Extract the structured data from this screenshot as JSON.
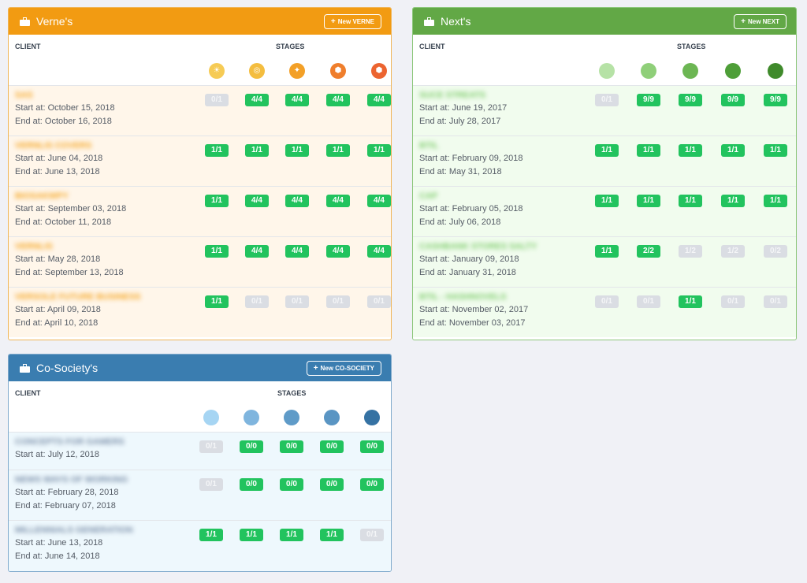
{
  "panels": [
    {
      "id": "verne",
      "title": "Verne's",
      "new_label": "New VERNE",
      "colors": {
        "header": "#f29b12",
        "border": "#f0b556",
        "row_bg": "#fff6ea",
        "name": "#f5a623"
      },
      "client_label": "CLIENT",
      "stages_label": "STAGES",
      "stage_icons": [
        {
          "name": "sun-icon",
          "color": "#f6cb55"
        },
        {
          "name": "globe-icon",
          "color": "#f4bd3f"
        },
        {
          "name": "compass-icon",
          "color": "#f3a027"
        },
        {
          "name": "cube-icon",
          "color": "#ef7e2c"
        },
        {
          "name": "box-icon",
          "color": "#ec6430"
        }
      ],
      "rows": [
        {
          "name": "SAS",
          "start": "Start at: October 15, 2018",
          "end": "End at: October 16, 2018",
          "stages": [
            {
              "v": "0/1",
              "s": "x"
            },
            {
              "v": "4/4",
              "s": "g"
            },
            {
              "v": "4/4",
              "s": "g"
            },
            {
              "v": "4/4",
              "s": "g"
            },
            {
              "v": "4/4",
              "s": "g"
            }
          ]
        },
        {
          "name": "VERNLIS COVERS",
          "start": "Start at: June 04, 2018",
          "end": "End at: June 13, 2018",
          "stages": [
            {
              "v": "1/1",
              "s": "g"
            },
            {
              "v": "1/1",
              "s": "g"
            },
            {
              "v": "1/1",
              "s": "g"
            },
            {
              "v": "1/1",
              "s": "g"
            },
            {
              "v": "1/1",
              "s": "g"
            }
          ]
        },
        {
          "name": "BIOSAKWPY",
          "start": "Start at: September 03, 2018",
          "end": "End at: October 11, 2018",
          "stages": [
            {
              "v": "1/1",
              "s": "g"
            },
            {
              "v": "4/4",
              "s": "g"
            },
            {
              "v": "4/4",
              "s": "g"
            },
            {
              "v": "4/4",
              "s": "g"
            },
            {
              "v": "4/4",
              "s": "g"
            }
          ]
        },
        {
          "name": "VERNLIS",
          "start": "Start at: May 28, 2018",
          "end": "End at: September 13, 2018",
          "stages": [
            {
              "v": "1/1",
              "s": "g"
            },
            {
              "v": "4/4",
              "s": "g"
            },
            {
              "v": "4/4",
              "s": "g"
            },
            {
              "v": "4/4",
              "s": "g"
            },
            {
              "v": "4/4",
              "s": "g"
            }
          ]
        },
        {
          "name": "VERSOLE FUTURE BUSINESS",
          "start": "Start at: April 09, 2018",
          "end": "End at: April 10, 2018",
          "stages": [
            {
              "v": "1/1",
              "s": "g"
            },
            {
              "v": "0/1",
              "s": "x"
            },
            {
              "v": "0/1",
              "s": "x"
            },
            {
              "v": "0/1",
              "s": "x"
            },
            {
              "v": "0/1",
              "s": "x"
            }
          ]
        }
      ]
    },
    {
      "id": "next",
      "title": "Next's",
      "new_label": "New NEXT",
      "colors": {
        "header": "#62a846",
        "border": "#8cc77a",
        "row_bg": "#f1fcee",
        "name": "#7dcc6a"
      },
      "client_label": "CLIENT",
      "stages_label": "STAGES",
      "stage_icons": [
        {
          "name": "stage-1-dot-icon",
          "color": "#b6e2a6"
        },
        {
          "name": "stage-2-dot-icon",
          "color": "#8fcf79"
        },
        {
          "name": "stage-3-dot-icon",
          "color": "#6cb653"
        },
        {
          "name": "stage-4-dot-icon",
          "color": "#4e9e38"
        },
        {
          "name": "stage-5-dot-icon",
          "color": "#3f8a2b"
        }
      ],
      "rows": [
        {
          "name": "SUCE STREATS",
          "start": "Start at: June 19, 2017",
          "end": "End at: July 28, 2017",
          "stages": [
            {
              "v": "0/1",
              "s": "x"
            },
            {
              "v": "9/9",
              "s": "g"
            },
            {
              "v": "9/9",
              "s": "g"
            },
            {
              "v": "9/9",
              "s": "g"
            },
            {
              "v": "9/9",
              "s": "g"
            }
          ]
        },
        {
          "name": "BTIL",
          "start": "Start at: February 09, 2018",
          "end": "End at: May 31, 2018",
          "stages": [
            {
              "v": "1/1",
              "s": "g"
            },
            {
              "v": "1/1",
              "s": "g"
            },
            {
              "v": "1/1",
              "s": "g"
            },
            {
              "v": "1/1",
              "s": "g"
            },
            {
              "v": "1/1",
              "s": "g"
            }
          ]
        },
        {
          "name": "CAP",
          "start": "Start at: February 05, 2018",
          "end": "End at: July 06, 2018",
          "stages": [
            {
              "v": "1/1",
              "s": "g"
            },
            {
              "v": "1/1",
              "s": "g"
            },
            {
              "v": "1/1",
              "s": "g"
            },
            {
              "v": "1/1",
              "s": "g"
            },
            {
              "v": "1/1",
              "s": "g"
            }
          ]
        },
        {
          "name": "CASHBANK STORES SALTY",
          "start": "Start at: January 09, 2018",
          "end": "End at: January 31, 2018",
          "stages": [
            {
              "v": "1/1",
              "s": "g"
            },
            {
              "v": "2/2",
              "s": "g"
            },
            {
              "v": "1/2",
              "s": "x"
            },
            {
              "v": "1/2",
              "s": "x"
            },
            {
              "v": "0/2",
              "s": "x"
            }
          ]
        },
        {
          "name": "BTIL - HASHNOVELS",
          "start": "Start at: November 02, 2017",
          "end": "End at: November 03, 2017",
          "stages": [
            {
              "v": "0/1",
              "s": "x"
            },
            {
              "v": "0/1",
              "s": "x"
            },
            {
              "v": "1/1",
              "s": "g"
            },
            {
              "v": "0/1",
              "s": "x"
            },
            {
              "v": "0/1",
              "s": "x"
            }
          ]
        }
      ]
    },
    {
      "id": "cosociety",
      "title": "Co-Society's",
      "new_label": "New CO-SOCIETY",
      "colors": {
        "header": "#3a7db0",
        "border": "#7fa9cc",
        "row_bg": "#eef8fd",
        "name": "#7a8ea8"
      },
      "client_label": "CLIENT",
      "stages_label": "STAGES",
      "stage_icons": [
        {
          "name": "stage-1-dot-icon",
          "color": "#a6d5f3"
        },
        {
          "name": "stage-2-dot-icon",
          "color": "#7fb5de"
        },
        {
          "name": "stage-3-dot-icon",
          "color": "#5f9bc8"
        },
        {
          "name": "stage-4-dot-icon",
          "color": "#5a95c3"
        },
        {
          "name": "stage-5-dot-icon",
          "color": "#3572a3"
        }
      ],
      "rows": [
        {
          "name": "CONCEPTS FOR GAMERS",
          "start": "Start at: July 12, 2018",
          "end": "",
          "stages": [
            {
              "v": "0/1",
              "s": "x"
            },
            {
              "v": "0/0",
              "s": "g"
            },
            {
              "v": "0/0",
              "s": "g"
            },
            {
              "v": "0/0",
              "s": "g"
            },
            {
              "v": "0/0",
              "s": "g"
            }
          ]
        },
        {
          "name": "NEWS WAYS OF WORKING",
          "start": "Start at: February 28, 2018",
          "end": "End at: February 07, 2018",
          "stages": [
            {
              "v": "0/1",
              "s": "x"
            },
            {
              "v": "0/0",
              "s": "g"
            },
            {
              "v": "0/0",
              "s": "g"
            },
            {
              "v": "0/0",
              "s": "g"
            },
            {
              "v": "0/0",
              "s": "g"
            }
          ]
        },
        {
          "name": "MILLENNIALS GENERATION",
          "start": "Start at: June 13, 2018",
          "end": "End at: June 14, 2018",
          "stages": [
            {
              "v": "1/1",
              "s": "g"
            },
            {
              "v": "1/1",
              "s": "g"
            },
            {
              "v": "1/1",
              "s": "g"
            },
            {
              "v": "1/1",
              "s": "g"
            },
            {
              "v": "0/1",
              "s": "x"
            }
          ]
        }
      ]
    }
  ]
}
